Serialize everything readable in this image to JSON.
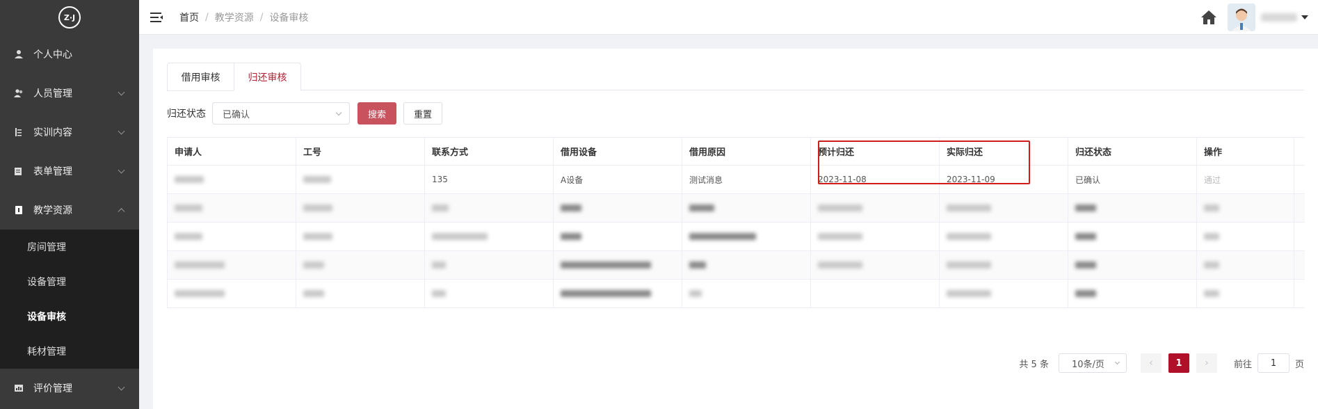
{
  "sidebar": {
    "logo_text": "Z·J",
    "items": [
      {
        "label": "个人中心"
      },
      {
        "label": "人员管理"
      },
      {
        "label": "实训内容"
      },
      {
        "label": "表单管理"
      },
      {
        "label": "教学资源"
      },
      {
        "label": "评价管理"
      }
    ],
    "sub_items": [
      {
        "label": "房间管理"
      },
      {
        "label": "设备管理"
      },
      {
        "label": "设备审核"
      },
      {
        "label": "耗材管理"
      }
    ]
  },
  "breadcrumb": [
    "首页",
    "教学资源",
    "设备审核"
  ],
  "breadcrumb_sep": "/",
  "tabs": [
    {
      "label": "借用审核"
    },
    {
      "label": "归还审核"
    }
  ],
  "filter": {
    "label": "归还状态",
    "selected": "已确认",
    "search_label": "搜索",
    "reset_label": "重置"
  },
  "table": {
    "columns": [
      "申请人",
      "工号",
      "联系方式",
      "借用设备",
      "借用原因",
      "预计归还",
      "实际归还",
      "归还状态",
      "操作"
    ],
    "row1": {
      "applicant": "",
      "id": "",
      "contact": "135",
      "device": "A设备",
      "reason": "测试消息",
      "expected_return": "2023-11-08",
      "actual_return": "2023-11-09",
      "status": "已确认",
      "action": "通过"
    }
  },
  "pagination": {
    "total": "共 5 条",
    "page_size": "10条/页",
    "current_page": "1",
    "goto_prefix": "前往",
    "goto_value": "1",
    "goto_suffix": "页"
  },
  "colors": {
    "accent": "#b0102a",
    "search_button": "#c9525f",
    "highlight_border": "#d11c1c",
    "sidebar_bg": "#3a3a3a",
    "submenu_bg": "#1f1f1f"
  }
}
